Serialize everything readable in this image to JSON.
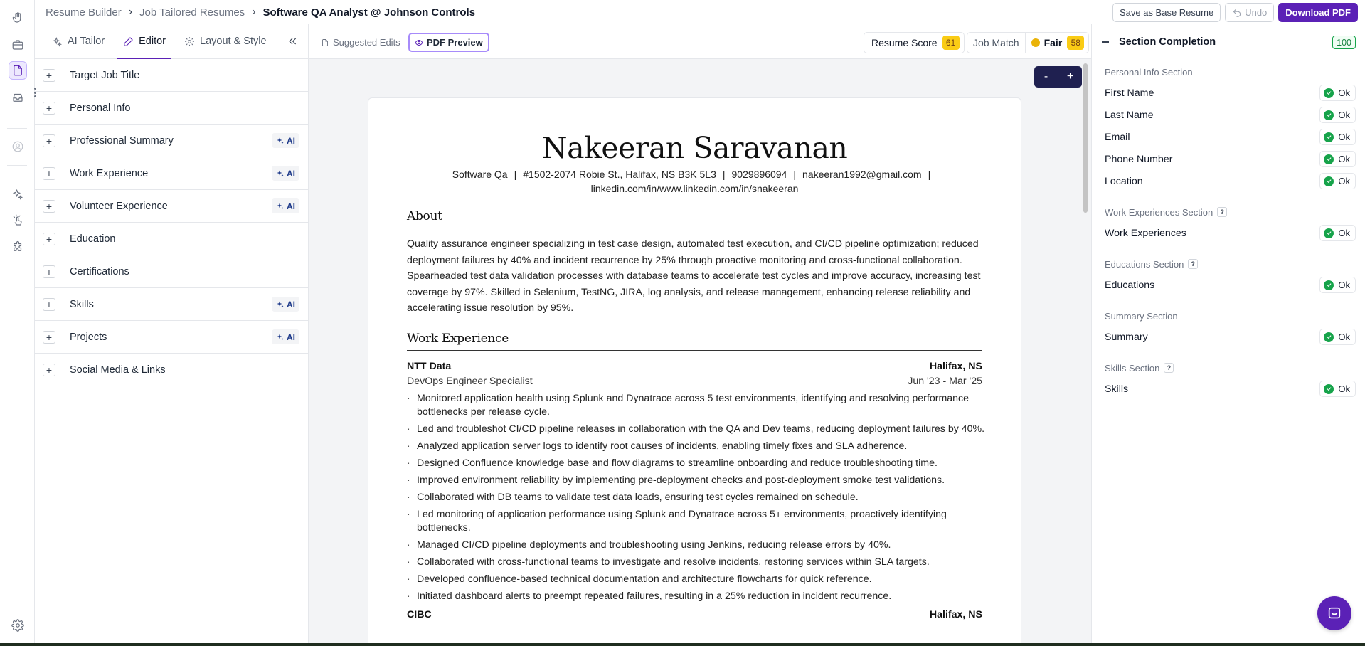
{
  "breadcrumb": {
    "items": [
      "Resume Builder",
      "Job Tailored Resumes",
      "Software QA Analyst @ Johnson Controls"
    ]
  },
  "actions": {
    "save_base": "Save as Base Resume",
    "undo": "Undo",
    "download": "Download PDF"
  },
  "left_tabs": {
    "ai_tailor": "AI Tailor",
    "editor": "Editor",
    "layout": "Layout & Style"
  },
  "sections": [
    {
      "label": "Target Job Title",
      "ai": ""
    },
    {
      "label": "Personal Info",
      "ai": ""
    },
    {
      "label": "Professional Summary",
      "ai": "AI"
    },
    {
      "label": "Work Experience",
      "ai": "AI"
    },
    {
      "label": "Volunteer Experience",
      "ai": "AI"
    },
    {
      "label": "Education",
      "ai": ""
    },
    {
      "label": "Certifications",
      "ai": ""
    },
    {
      "label": "Skills",
      "ai": "AI"
    },
    {
      "label": "Projects",
      "ai": "AI"
    },
    {
      "label": "Social Media & Links",
      "ai": ""
    }
  ],
  "view_tabs": {
    "suggested": "Suggested Edits",
    "preview": "PDF Preview"
  },
  "scores": {
    "resume_label": "Resume Score",
    "resume_value": "61",
    "job_match_label": "Job Match",
    "job_match_status": "Fair",
    "job_match_value": "58"
  },
  "zoom": {
    "minus": "-",
    "plus": "+"
  },
  "resume": {
    "name": "Nakeeran Saravanan",
    "contact_line1": [
      "Software Qa",
      "#1502-2074 Robie St., Halifax, NS B3K 5L3",
      "9029896094",
      "nakeeran1992@gmail.com",
      "|"
    ],
    "contact_line2": "linkedin.com/in/www.linkedin.com/in/snakeeran",
    "about_heading": "About",
    "about_text": "Quality assurance engineer specializing in test case design, automated test execution, and CI/CD pipeline optimization; reduced deployment failures by 40% and incident recurrence by 25% through proactive monitoring and cross-functional collaboration. Spearheaded test data validation processes with database teams to accelerate test cycles and improve accuracy, increasing test coverage by 97%. Skilled in Selenium, TestNG, JIRA, log analysis, and release management, enhancing release reliability and accelerating issue resolution by 95%.",
    "work_heading": "Work Experience",
    "job1": {
      "company": "NTT Data",
      "location": "Halifax, NS",
      "title": "DevOps Engineer Specialist",
      "dates": "Jun '23 - Mar '25",
      "bullets": [
        "Monitored application health using Splunk and Dynatrace across 5 test environments, identifying and resolving  performance bottlenecks per release cycle.",
        "Led and troubleshot CI/CD pipeline releases in collaboration with the QA and Dev teams, reducing deployment failures by 40%.",
        "Analyzed application server logs to identify root causes of incidents, enabling timely fixes and SLA adherence.",
        "Designed Confluence knowledge base and flow diagrams to streamline onboarding and reduce troubleshooting time.",
        "Improved environment reliability by implementing pre-deployment checks and post-deployment smoke test validations.",
        "Collaborated with DB teams to validate test data loads, ensuring test cycles remained on schedule.",
        "Led monitoring of application performance using Splunk and Dynatrace across 5+ environments, proactively identifying bottlenecks.",
        "Managed CI/CD pipeline deployments and troubleshooting using Jenkins, reducing release errors by 40%.",
        "Collaborated with cross-functional teams to investigate and resolve incidents, restoring services within SLA targets.",
        "Developed confluence-based technical documentation and architecture flowcharts for quick reference.",
        "Initiated dashboard alerts to preempt repeated failures, resulting in a 25% reduction in incident recurrence."
      ]
    },
    "job2": {
      "company": "CIBC",
      "location": "Halifax, NS"
    }
  },
  "completion": {
    "title": "Section Completion",
    "total": "100",
    "ok_label": "Ok",
    "groups": [
      {
        "title": "Personal Info Section",
        "help": "",
        "items": [
          "First Name",
          "Last Name",
          "Email",
          "Phone Number",
          "Location"
        ]
      },
      {
        "title": "Work Experiences Section",
        "help": "?",
        "items": [
          "Work Experiences"
        ]
      },
      {
        "title": "Educations Section",
        "help": "?",
        "items": [
          "Educations"
        ]
      },
      {
        "title": "Summary Section",
        "help": "",
        "items": [
          "Summary"
        ]
      },
      {
        "title": "Skills Section",
        "help": "?",
        "items": [
          "Skills"
        ]
      }
    ]
  },
  "colors": {
    "brand": "#5b21b6",
    "score_badge": "#facc15",
    "ok_green": "#16a34a"
  },
  "icons": [
    "hand-icon",
    "briefcase-icon",
    "document-icon",
    "inbox-icon",
    "avatar-icon",
    "sparkle-icon",
    "touch-icon",
    "puzzle-icon",
    "settings-icon",
    "chat-icon"
  ]
}
